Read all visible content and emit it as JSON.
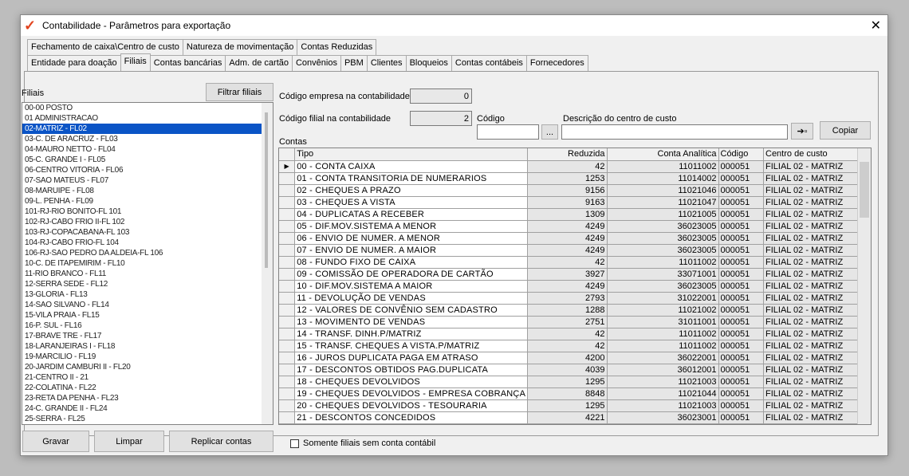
{
  "window": {
    "title": "Contabilidade - Parâmetros para exportação"
  },
  "tabs_row1": [
    "Fechamento de caixa\\Centro de custo",
    "Natureza de movimentação",
    "Contas Reduzidas"
  ],
  "tabs_row2": [
    "Entidade para doação",
    "Filiais",
    "Contas bancárias",
    "Adm. de cartão",
    "Convênios",
    "PBM",
    "Clientes",
    "Bloqueios",
    "Contas contábeis",
    "Fornecedores"
  ],
  "filiais": {
    "label": "Filiais",
    "filter_button": "Filtrar filiais",
    "selected_index": 2,
    "items": [
      "00-00 POSTO",
      "01 ADMINISTRACAO",
      "02-MATRIZ - FL02",
      "03-C. DE ARACRUZ - FL03",
      "04-MAURO NETTO - FL04",
      "05-C. GRANDE I - FL05",
      "06-CENTRO VITORIA - FL06",
      "07-SAO MATEUS - FL07",
      "08-MARUIPE - FL08",
      "09-L. PENHA - FL09",
      "101-RJ-RIO BONITO-FL 101",
      "102-RJ-CABO FRIO II-FL 102",
      "103-RJ-COPACABANA-FL 103",
      "104-RJ-CABO FRIO-FL 104",
      "106-RJ-SAO PEDRO DA ALDEIA-FL 106",
      "10-C. DE ITAPEMIRIM - FL10",
      "11-RIO BRANCO - FL11",
      "12-SERRA SEDE - FL12",
      "13-GLORIA - FL13",
      "14-SAO SILVANO - FL14",
      "15-VILA PRAIA - FL15",
      "16-P. SUL - FL16",
      "17-BRAVE TRE - FL17",
      "18-LARANJEIRAS I - FL18",
      "19-MARCILIO - FL19",
      "20-JARDIM CAMBURI II - FL20",
      "21-CENTRO II - 21",
      "22-COLATINA - FL22",
      "23-RETA DA PENHA - FL23",
      "24-C. GRANDE II - FL24",
      "25-SERRA - FL25"
    ]
  },
  "buttons": {
    "save": "Gravar",
    "clear": "Limpar",
    "replicate": "Replicar contas",
    "copy": "Copiar",
    "ellipsis": "..."
  },
  "checkbox": {
    "label": "Somente filiais sem conta contábil",
    "checked": false
  },
  "fields": {
    "empresa_label": "Código empresa na contabilidade",
    "empresa_value": "0",
    "filial_label": "Código filial na contabilidade",
    "filial_value": "2",
    "codigo_label": "Código",
    "codigo_value": "",
    "descricao_label": "Descrição do centro de custo",
    "descricao_value": ""
  },
  "contas": {
    "label": "Contas",
    "columns": [
      "Tipo",
      "Reduzida",
      "Conta Analítica",
      "Código",
      "Centro de custo"
    ],
    "rows": [
      [
        "00 - CONTA CAIXA",
        "42",
        "11011002",
        "000051",
        "FILIAL 02 - MATRIZ"
      ],
      [
        "01 - CONTA TRANSITORIA DE NUMERARIOS",
        "1253",
        "11014002",
        "000051",
        "FILIAL 02 - MATRIZ"
      ],
      [
        "02 - CHEQUES A PRAZO",
        "9156",
        "11021046",
        "000051",
        "FILIAL 02 - MATRIZ"
      ],
      [
        "03 - CHEQUES A VISTA",
        "9163",
        "11021047",
        "000051",
        "FILIAL 02 - MATRIZ"
      ],
      [
        "04 - DUPLICATAS A RECEBER",
        "1309",
        "11021005",
        "000051",
        "FILIAL 02 - MATRIZ"
      ],
      [
        "05 - DIF.MOV.SISTEMA A MENOR",
        "4249",
        "36023005",
        "000051",
        "FILIAL 02 - MATRIZ"
      ],
      [
        "06 - ENVIO DE NUMER. A MENOR",
        "4249",
        "36023005",
        "000051",
        "FILIAL 02 - MATRIZ"
      ],
      [
        "07 - ENVIO DE NUMER. A MAIOR",
        "4249",
        "36023005",
        "000051",
        "FILIAL 02 - MATRIZ"
      ],
      [
        "08 - FUNDO FIXO DE CAIXA",
        "42",
        "11011002",
        "000051",
        "FILIAL 02 - MATRIZ"
      ],
      [
        "09 - COMISSÃO DE OPERADORA DE CARTÃO",
        "3927",
        "33071001",
        "000051",
        "FILIAL 02 - MATRIZ"
      ],
      [
        "10 - DIF.MOV.SISTEMA A MAIOR",
        "4249",
        "36023005",
        "000051",
        "FILIAL 02 - MATRIZ"
      ],
      [
        "11 - DEVOLUÇÃO DE VENDAS",
        "2793",
        "31022001",
        "000051",
        "FILIAL 02 - MATRIZ"
      ],
      [
        "12 - VALORES DE CONVÊNIO SEM CADASTRO",
        "1288",
        "11021002",
        "000051",
        "FILIAL 02 - MATRIZ"
      ],
      [
        "13 - MOVIMENTO DE VENDAS",
        "2751",
        "31011001",
        "000051",
        "FILIAL 02 - MATRIZ"
      ],
      [
        "14 - TRANSF. DINH.P/MATRIZ",
        "42",
        "11011002",
        "000051",
        "FILIAL 02 - MATRIZ"
      ],
      [
        "15 - TRANSF. CHEQUES A VISTA.P/MATRIZ",
        "42",
        "11011002",
        "000051",
        "FILIAL 02 - MATRIZ"
      ],
      [
        "16 - JUROS DUPLICATA PAGA EM ATRASO",
        "4200",
        "36022001",
        "000051",
        "FILIAL 02 - MATRIZ"
      ],
      [
        "17 - DESCONTOS OBTIDOS PAG.DUPLICATA",
        "4039",
        "36012001",
        "000051",
        "FILIAL 02 - MATRIZ"
      ],
      [
        "18 - CHEQUES DEVOLVIDOS",
        "1295",
        "11021003",
        "000051",
        "FILIAL 02 - MATRIZ"
      ],
      [
        "19 - CHEQUES DEVOLVIDOS - EMPRESA COBRANÇA",
        "8848",
        "11021044",
        "000051",
        "FILIAL 02 - MATRIZ"
      ],
      [
        "20 - CHEQUES DEVOLVIDOS - TESOURARIA",
        "1295",
        "11021003",
        "000051",
        "FILIAL 02 - MATRIZ"
      ],
      [
        "21 - DESCONTOS CONCEDIDOS",
        "4221",
        "36023001",
        "000051",
        "FILIAL 02 - MATRIZ"
      ]
    ]
  }
}
